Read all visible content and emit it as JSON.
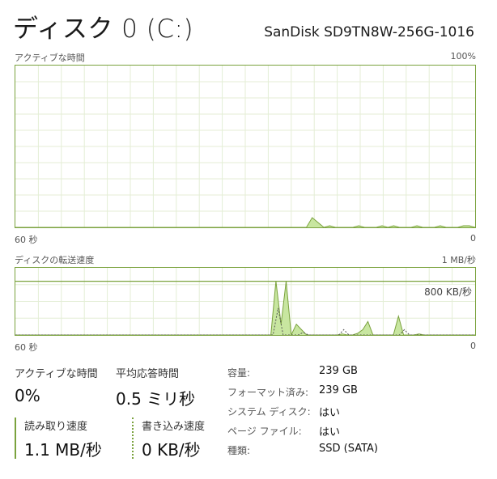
{
  "header": {
    "title": "ディスク 0 (C:)",
    "model": "SanDisk SD9TN8W-256G-1016"
  },
  "active_chart": {
    "label": "アクティブな時間",
    "max_label": "100%",
    "time_label": "60 秒",
    "zero_label": "0",
    "series_color": "#7aa23d",
    "fill_color": "#c8e6a0",
    "values": [
      0,
      0,
      0,
      0,
      0,
      0,
      0,
      0,
      0,
      0,
      0,
      0,
      0,
      0,
      0,
      0,
      0,
      0,
      0,
      0,
      0,
      0,
      0,
      0,
      0,
      0,
      0,
      0,
      0,
      0,
      0,
      0,
      0,
      0,
      0,
      0,
      0,
      0,
      0,
      0,
      0,
      0,
      0,
      0,
      0,
      0,
      0,
      0,
      0,
      0,
      0,
      6,
      3,
      0,
      1,
      0,
      0,
      0,
      0,
      1,
      0,
      0,
      0,
      1,
      0,
      1,
      0,
      0,
      0,
      1,
      0,
      0,
      0,
      1,
      0,
      0,
      0,
      1,
      1,
      0
    ]
  },
  "transfer_chart": {
    "label": "ディスクの転送速度",
    "max_label": "1 MB/秒",
    "ref_label": "800 KB/秒",
    "time_label": "60 秒",
    "zero_label": "0",
    "read_values": [
      0,
      0,
      0,
      0,
      0,
      0,
      0,
      0,
      0,
      0,
      0,
      0,
      0,
      0,
      0,
      0,
      0,
      0,
      0,
      0,
      0,
      0,
      0,
      0,
      0,
      0,
      0,
      0,
      0,
      0,
      0,
      0,
      0,
      0,
      0,
      0,
      0,
      0,
      0,
      0,
      0,
      0,
      0,
      0,
      0,
      0,
      0,
      0,
      0,
      0,
      0,
      10,
      2,
      10,
      0,
      2,
      1,
      0,
      0,
      0,
      0,
      0,
      0,
      0,
      0.2,
      0,
      0,
      0.3,
      1,
      2.5,
      0,
      0,
      0,
      0,
      0,
      3.5,
      0,
      0,
      0,
      0.2,
      0,
      0,
      0,
      0,
      0,
      0,
      0,
      0,
      0,
      0,
      0
    ],
    "write_values": [
      0,
      0,
      0,
      0,
      0,
      0,
      0,
      0,
      0,
      0,
      0,
      0,
      0,
      0,
      0,
      0,
      0,
      0,
      0,
      0,
      0,
      0,
      0,
      0,
      0,
      0,
      0,
      0,
      0,
      0,
      0,
      0,
      0,
      0,
      0,
      0,
      0,
      0,
      0,
      0,
      0,
      0,
      0,
      0,
      0,
      0,
      0,
      0,
      0,
      0,
      0,
      0,
      5,
      0,
      0,
      0,
      0,
      0.5,
      0,
      0,
      0,
      0,
      0,
      0,
      0,
      1,
      0,
      0,
      0,
      0,
      0,
      0,
      0,
      0,
      0,
      0,
      0,
      1,
      0,
      0,
      0,
      0,
      0,
      0,
      0,
      0,
      0,
      0,
      0,
      0,
      0,
      0
    ]
  },
  "stats": {
    "active_time_label": "アクティブな時間",
    "active_time_value": "0%",
    "avg_response_label": "平均応答時間",
    "avg_response_value": "0.5 ミリ秒",
    "read_speed_label": "読み取り速度",
    "read_speed_value": "1.1 MB/秒",
    "write_speed_label": "書き込み速度",
    "write_speed_value": "0 KB/秒"
  },
  "properties": [
    {
      "label": "容量:",
      "value": "239 GB"
    },
    {
      "label": "フォーマット済み:",
      "value": "239 GB"
    },
    {
      "label": "システム ディスク:",
      "value": "はい"
    },
    {
      "label": "ページ ファイル:",
      "value": "はい"
    },
    {
      "label": "種類:",
      "value": "SSD (SATA)"
    }
  ]
}
